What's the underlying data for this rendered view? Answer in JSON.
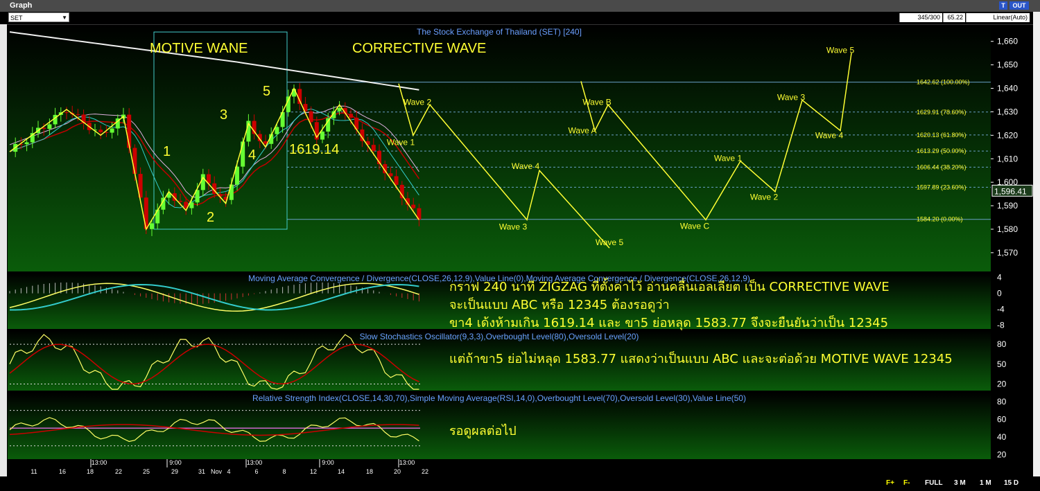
{
  "window": {
    "title": "Graph",
    "btn_t": "T",
    "btn_out": "OUT"
  },
  "toolbar": {
    "symbol": "SET",
    "bars_info": "345/300",
    "value_info": "65.22",
    "scale_mode": "Linear(Auto)"
  },
  "bottom": {
    "f_plus": "F+",
    "f_minus": "F-",
    "full": "FULL",
    "m3": "3 M",
    "m1": "1 M",
    "d15": "15 D"
  },
  "colors": {
    "bg_top": "#000000",
    "bg_bottom": "#0a5c0a",
    "zigzag": "#ffff33",
    "macd_line": "#ffff66",
    "signal_line": "#33cccc",
    "stoch_slow": "#cc0000",
    "ma_white": "#f0f0f0",
    "bull_candle": "#66ff33",
    "bear_candle": "#cc0000"
  },
  "notes": {
    "line1": "กราฟ 240 นาที ZIGZAG ที่ตั้งค่าไว้ อ่านคลื่นเอลเลียต เป็น CORRECTIVE WAVE",
    "line2": "จะเป็นแบบ ABC หรือ 12345 ต้องรอดูว่า",
    "line3": "ขา4 เด้งห้ามเกิน 1619.14 และ ขา5 ย่อหลุด 1583.77 จึงจะยืนยันว่าเป็น 12345",
    "line4": "แต่ถ้าขา5 ย่อไม่หลุด 1583.77 แสดงว่าเป็นแบบ ABC และจะต่อด้วย MOTIVE WAVE 12345",
    "line5": "รอดูผลต่อไป"
  },
  "chart_data": [
    {
      "type": "candlestick",
      "title": "The Stock Exchange of Thailand (SET) [240]",
      "ylim": [
        1562,
        1667
      ],
      "yticks": [
        "1,570",
        "1,580",
        "1,590",
        "1,600",
        "1,610",
        "1,620",
        "1,630",
        "1,640",
        "1,650",
        "1,660"
      ],
      "last_price": "1,596.41",
      "labels": {
        "motive": "MOTIVE WANE",
        "corrective": "CORRECTIVE WAVE",
        "w1": "1",
        "w2": "2",
        "w3": "3",
        "w4": "4",
        "w5": "5",
        "level": "1619.14"
      },
      "zigzag_actual": [
        {
          "bar": 0,
          "y": 1613
        },
        {
          "bar": 10,
          "y": 1631
        },
        {
          "bar": 16,
          "y": 1620
        },
        {
          "bar": 20,
          "y": 1628
        },
        {
          "bar": 24,
          "y": 1580
        },
        {
          "bar": 28,
          "y": 1596
        },
        {
          "bar": 31,
          "y": 1588
        },
        {
          "bar": 34,
          "y": 1602
        },
        {
          "bar": 38,
          "y": 1591
        },
        {
          "bar": 42,
          "y": 1625
        },
        {
          "bar": 45,
          "y": 1615
        },
        {
          "bar": 50,
          "y": 1640
        },
        {
          "bar": 54,
          "y": 1619.14
        },
        {
          "bar": 58,
          "y": 1633
        },
        {
          "bar": 72,
          "y": 1584
        }
      ],
      "fib_levels": [
        {
          "label": "1642.62 (100.00%)",
          "value": 1642.62
        },
        {
          "label": "1629.91 (78.60%)",
          "value": 1629.91
        },
        {
          "label": "1620.13 (61.80%)",
          "value": 1620.13
        },
        {
          "label": "1613.29 (50.00%)",
          "value": 1613.29
        },
        {
          "label": "1606.44 (38.20%)",
          "value": 1606.44
        },
        {
          "label": "1597.89 (23.60%)",
          "value": 1597.89
        },
        {
          "label": "1584.20 (0.00%)",
          "value": 1584.2
        }
      ],
      "projection_12345": [
        {
          "label": "",
          "y": 1642
        },
        {
          "label": "Wave 1",
          "y": 1620
        },
        {
          "label": "Wave 2",
          "y": 1633
        },
        {
          "label": "Wave 3",
          "y": 1584
        },
        {
          "label": "Wave 4",
          "y": 1605
        },
        {
          "label": "Wave 5",
          "y": 1572
        }
      ],
      "projection_abc": [
        {
          "label": "",
          "y": 1643
        },
        {
          "label": "Wave A",
          "y": 1622
        },
        {
          "label": "Wave B",
          "y": 1633
        },
        {
          "label": "Wave C",
          "y": 1584
        },
        {
          "label": "Wave 1",
          "y": 1609
        },
        {
          "label": "Wave 2",
          "y": 1596
        },
        {
          "label": "Wave 3",
          "y": 1635
        },
        {
          "label": "Wave 4",
          "y": 1622
        },
        {
          "label": "Wave 5",
          "y": 1655
        }
      ]
    },
    {
      "type": "line",
      "title": "Moving Average Convergence / Divergence(CLOSE,26,12,9),Value Line(0),Moving Average Convergence / Divergence(CLOSE,26,12,9)",
      "ylim": [
        -9,
        5
      ],
      "yticks": [
        "4",
        "0",
        "-4",
        "-8"
      ]
    },
    {
      "type": "line",
      "title": "Slow Stochastics Oscillator(9,3,3),Overbought Level(80),Oversold Level(20)",
      "ylim": [
        10,
        100
      ],
      "yticks": [
        "80",
        "50",
        "20"
      ]
    },
    {
      "type": "line",
      "title": "Relative Strength Index(CLOSE,14,30,70),Simple Moving Average(RSI,14,0),Overbought Level(70),Oversold Level(30),Value Line(50)",
      "ylim": [
        15,
        90
      ],
      "yticks": [
        "80",
        "60",
        "40",
        "20"
      ]
    }
  ],
  "xaxis": {
    "times": [
      "13:00",
      "9:00",
      "13:00",
      "9:00",
      "13:00"
    ],
    "days": [
      "11",
      "16",
      "18",
      "22",
      "25",
      "29",
      "31",
      "Nov",
      "4",
      "6",
      "8",
      "12",
      "14",
      "18",
      "20",
      "22"
    ]
  }
}
